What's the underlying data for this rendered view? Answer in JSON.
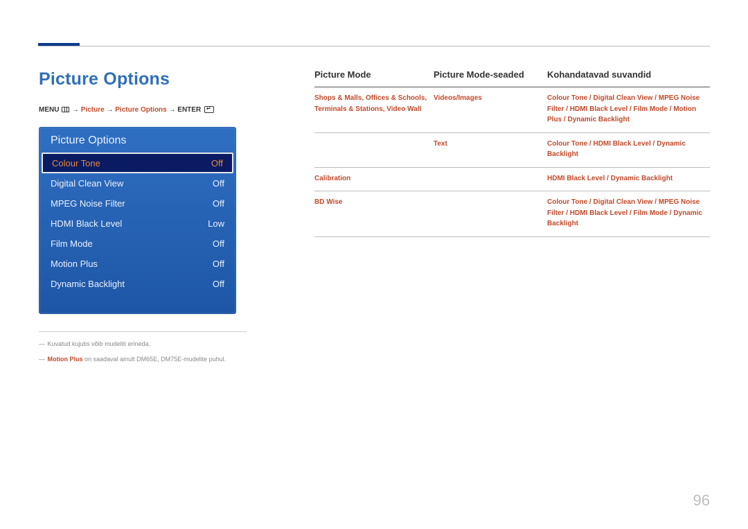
{
  "page": {
    "title": "Picture Options",
    "number": "96"
  },
  "breadcrumb": {
    "menu_label": "MENU",
    "seg1": "Picture",
    "seg2": "Picture Options",
    "enter_label": "ENTER"
  },
  "menu_panel": {
    "title": "Picture Options",
    "rows": [
      {
        "label": "Colour Tone",
        "value": "Off",
        "selected": true
      },
      {
        "label": "Digital Clean View",
        "value": "Off",
        "selected": false
      },
      {
        "label": "MPEG Noise Filter",
        "value": "Off",
        "selected": false
      },
      {
        "label": "HDMI Black Level",
        "value": "Low",
        "selected": false
      },
      {
        "label": "Film Mode",
        "value": "Off",
        "selected": false
      },
      {
        "label": "Motion Plus",
        "value": "Off",
        "selected": false
      },
      {
        "label": "Dynamic Backlight",
        "value": "Off",
        "selected": false
      }
    ]
  },
  "notes": {
    "line1": "Kuvatud kujutis võib mudeliti erineda.",
    "line2_hl": "Motion Plus",
    "line2_rest": " on saadaval ainult DM65E, DM75E-mudelite puhul."
  },
  "table": {
    "headers": {
      "col1": "Picture Mode",
      "col2": "Picture Mode-seaded",
      "col3": "Kohandatavad suvandid"
    },
    "rows": [
      {
        "c1": "Shops & Malls, Offices & Schools, Terminals & Stations, Video Wall",
        "c2": "Videos/Images",
        "c3_segments": [
          "Colour Tone",
          "Digital Clean View",
          "MPEG Noise Filter",
          "HDMI Black Level",
          "Film Mode",
          "Motion Plus",
          "Dynamic Backlight"
        ]
      },
      {
        "c1": "",
        "c2": "Text",
        "c3_segments": [
          "Colour Tone",
          "HDMI Black Level",
          "Dynamic Backlight"
        ]
      },
      {
        "c1": "Calibration",
        "c2": "",
        "c3_segments": [
          "HDMI Black Level",
          "Dynamic Backlight"
        ]
      },
      {
        "c1": "BD Wise",
        "c2": "",
        "c3_segments": [
          "Colour Tone",
          "Digital Clean View",
          "MPEG Noise Filter",
          "HDMI Black Level",
          "Film Mode",
          "Dynamic Backlight"
        ]
      }
    ]
  }
}
